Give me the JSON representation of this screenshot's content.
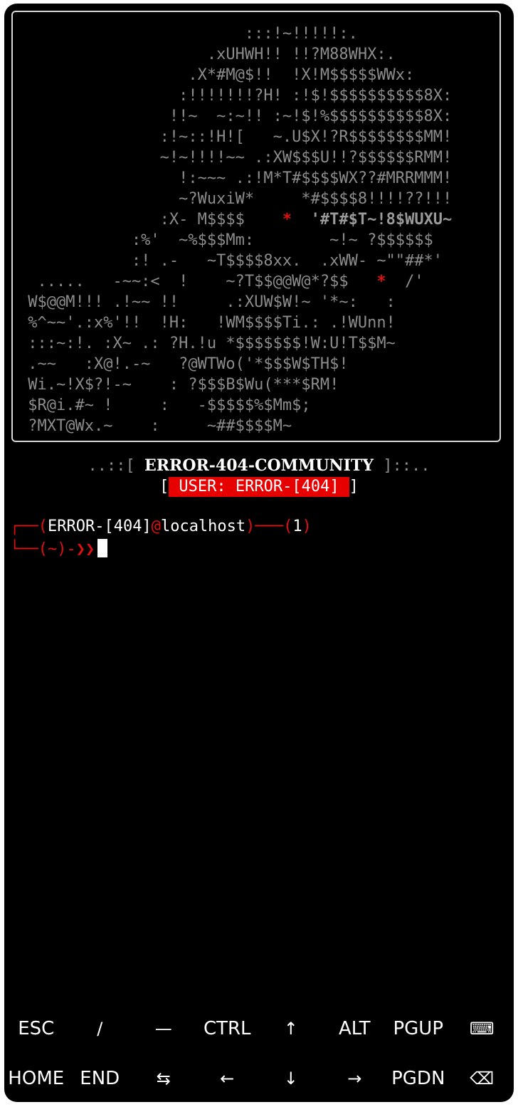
{
  "ascii_art": {
    "lines": [
      [
        {
          "t": "                        :::!~!!!!!:."
        }
      ],
      [
        {
          "t": "                    .xUHWH!! !!?M88WHX:."
        }
      ],
      [
        {
          "t": "                  .X*#M@$!!  !X!M$$$$$WWx:"
        }
      ],
      [
        {
          "t": "                 :!!!!!!!?H! :!$!$$$$$$$$$$8X:"
        }
      ],
      [
        {
          "t": "                !!~  ~:~!! :~!$!%$$$$$$$$$$8X:"
        }
      ],
      [
        {
          "t": "               :!~::!H![   ~.U$X!?R$$$$$$$$MM!"
        }
      ],
      [
        {
          "t": "               ~!~!!!!~~ .:XW$$$U!!?$$$$$$RMM!"
        }
      ],
      [
        {
          "t": "                 !:~~~ .:!M*T#$$$$WX??#MRRMMM!"
        }
      ],
      [
        {
          "t": "                 ~?WuxiW*     *#$$$$8!!!!??!!!"
        }
      ],
      [
        {
          "t": "               :X- M$$$$    "
        },
        {
          "t": "*",
          "c": "red"
        },
        {
          "t": "  "
        },
        {
          "t": "'#T#$T~!8$WUXU~",
          "c": "bold"
        }
      ],
      [
        {
          "t": "            :%'  ~%$$$Mm:        ~!~ ?$$$$$$"
        }
      ],
      [
        {
          "t": "            :! .-   ~T$$$$8xx.  .xWW- ~\"\"##*'"
        }
      ],
      [
        {
          "t": "  .....   -~~:<  !    ~?T$$@@W@*?$$   "
        },
        {
          "t": "*",
          "c": "red"
        },
        {
          "t": "  /'"
        }
      ],
      [
        {
          "t": " W$@@M!!! .!~~ !!     .:XUW$W!~ '*~:   :"
        }
      ],
      [
        {
          "t": " %^~~'.:x%'!!  !H:   !WM$$$$Ti.: .!WUnn!"
        }
      ],
      [
        {
          "t": " :::~:!. :X~ .: ?H.!u *$$$$$$$!W:U!T$$M~"
        }
      ],
      [
        {
          "t": " .~~   :X@!.-~   ?@WTWo('*$$$W$TH$!"
        }
      ],
      [
        {
          "t": " Wi.~!X$?!-~    : ?$$$B$Wu(***$RM!"
        }
      ],
      [
        {
          "t": " $R@i.#~ !     :   -$$$$$%$Mm$;"
        }
      ],
      [
        {
          "t": " ?MXT@Wx.~    :     ~##$$$$M~"
        }
      ]
    ]
  },
  "banner": {
    "left_deco": "..::[ ",
    "title": "ERROR-404-COMMUNITY",
    "right_deco": " ]::..",
    "bracket_open": "[",
    "user_label": "USER: ERROR-[404]",
    "bracket_close": "]"
  },
  "prompt": {
    "line1_corner": "┌──",
    "open_paren": "(",
    "user": "ERROR-[404]",
    "at": "@",
    "host": "localhost",
    "close_paren": ")",
    "dash": "───",
    "count_open": "(",
    "count": "1",
    "count_close": ")",
    "line2_corner": "└──",
    "dir_open": "(",
    "dir": "~",
    "dir_close": ")",
    "arrow": "-❯❯"
  },
  "extra_keys": {
    "row1": [
      {
        "label": "ESC",
        "name": "esc-key"
      },
      {
        "label": "/",
        "name": "slash-key"
      },
      {
        "label": "—",
        "name": "dash-key"
      },
      {
        "label": "CTRL",
        "name": "ctrl-key"
      },
      {
        "label": "↑",
        "name": "arrow-up-key"
      },
      {
        "label": "ALT",
        "name": "alt-key"
      },
      {
        "label": "PGUP",
        "name": "pgup-key"
      },
      {
        "label": "⌨",
        "name": "keyboard-icon"
      }
    ],
    "row2": [
      {
        "label": "HOME",
        "name": "home-key"
      },
      {
        "label": "END",
        "name": "end-key"
      },
      {
        "label": "⇆",
        "name": "tab-key"
      },
      {
        "label": "←",
        "name": "arrow-left-key"
      },
      {
        "label": "↓",
        "name": "arrow-down-key"
      },
      {
        "label": "→",
        "name": "arrow-right-key"
      },
      {
        "label": "PGDN",
        "name": "pgdn-key"
      },
      {
        "label": "⌫",
        "name": "backspace-icon"
      }
    ]
  },
  "colors": {
    "background": "#000000",
    "accent_red": "#e01010",
    "banner_red": "#e60000",
    "art_gray": "#8c8c8c"
  }
}
